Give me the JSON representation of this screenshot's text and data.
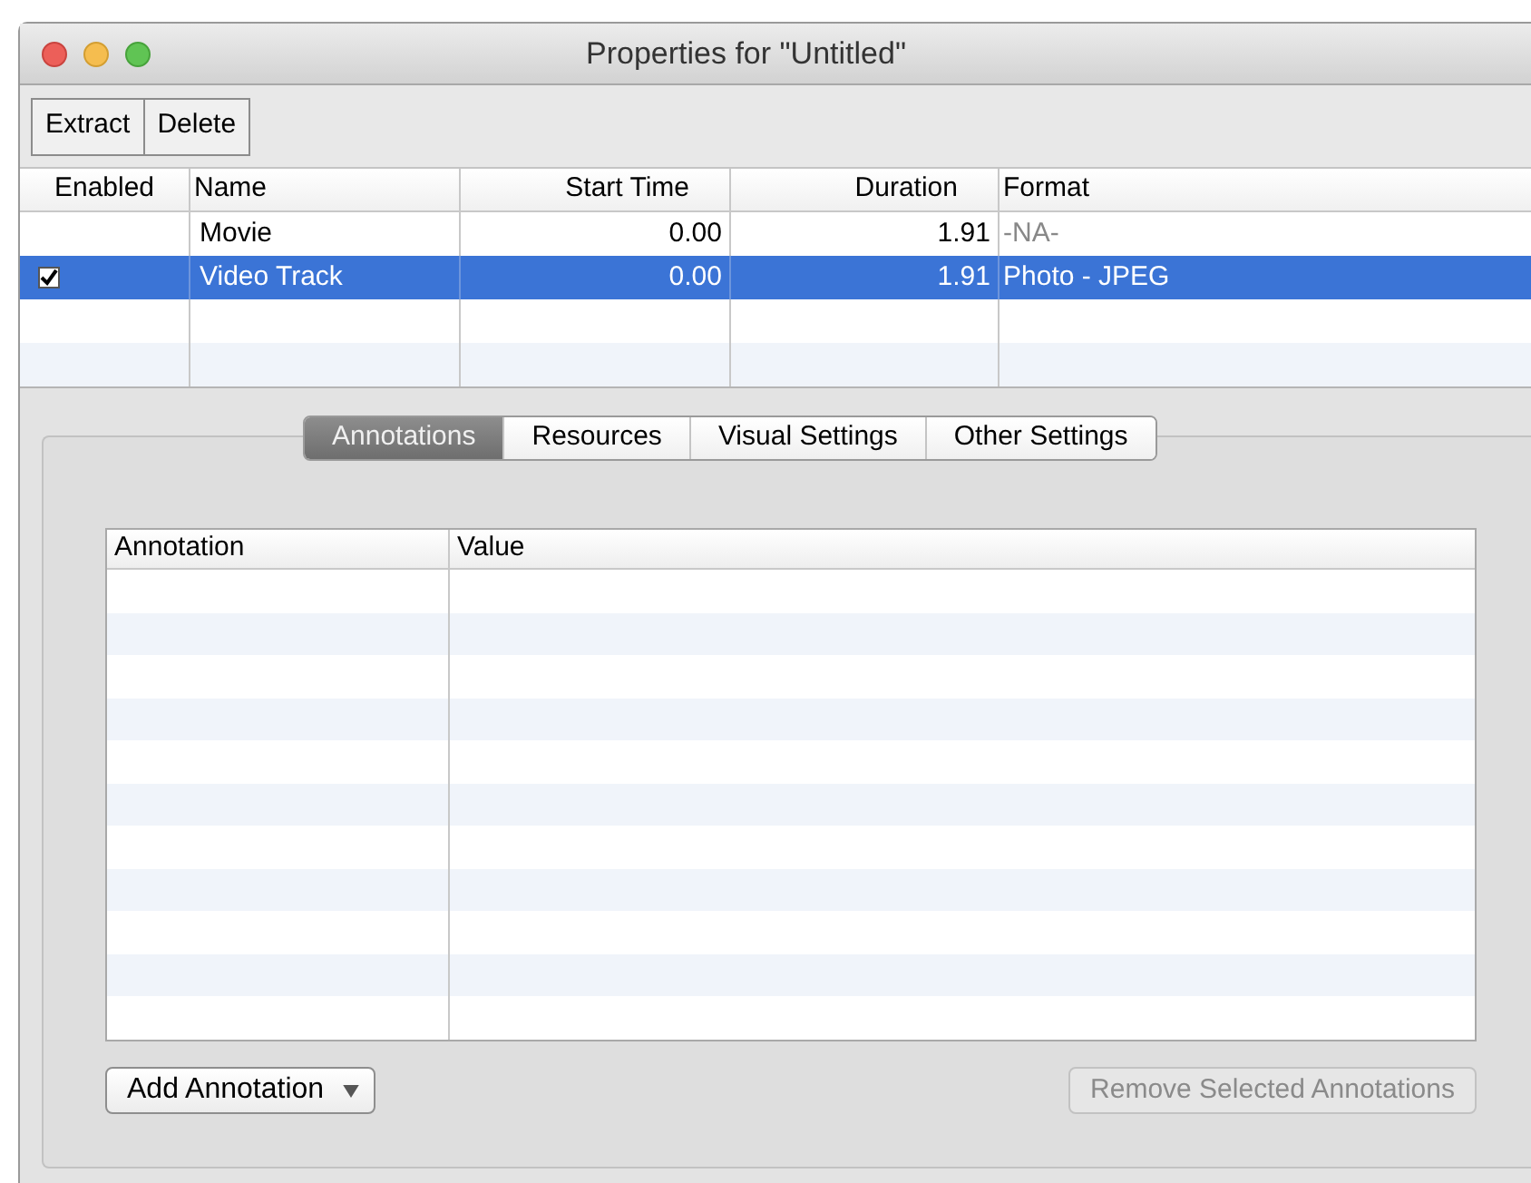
{
  "window": {
    "title": "Properties for \"Untitled\""
  },
  "toolbar": {
    "buttons": [
      "Extract",
      "Delete"
    ]
  },
  "tracks": {
    "columns": [
      "Enabled",
      "Name",
      "Start Time",
      "Duration",
      "Format"
    ],
    "rows": [
      {
        "enabled": false,
        "name": "Movie",
        "start_time": "0.00",
        "duration": "1.91",
        "format": "-NA-",
        "format_muted": true,
        "selected": false
      },
      {
        "enabled": true,
        "name": "Video Track",
        "start_time": "0.00",
        "duration": "1.91",
        "format": "Photo - JPEG",
        "format_muted": false,
        "selected": true
      }
    ]
  },
  "tabs": [
    {
      "label": "Annotations",
      "selected": true
    },
    {
      "label": "Resources",
      "selected": false
    },
    {
      "label": "Visual Settings",
      "selected": false
    },
    {
      "label": "Other Settings",
      "selected": false
    }
  ],
  "annotations": {
    "columns": [
      "Annotation",
      "Value"
    ]
  },
  "add_button": {
    "label": "Add Annotation",
    "disabled": false
  },
  "remove_button": {
    "label": "Remove Selected Annotations",
    "disabled": true
  }
}
